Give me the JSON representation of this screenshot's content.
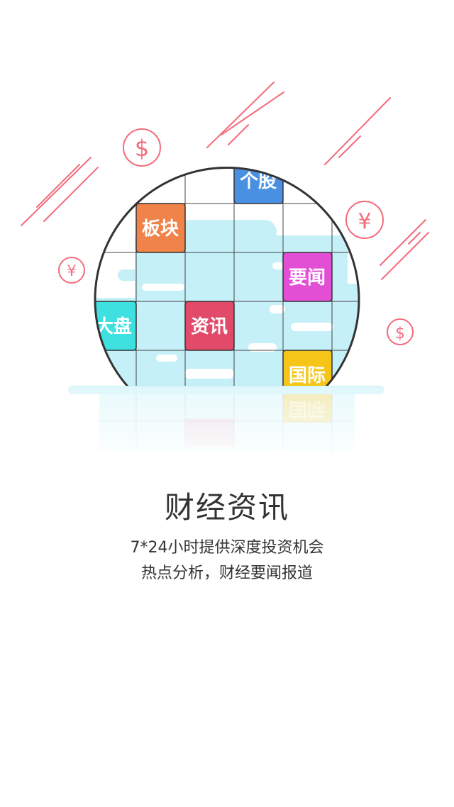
{
  "illustration": {
    "tiles": {
      "gegu": "个股",
      "bankuai": "板块",
      "yaowen": "要闻",
      "dapan": "大盘",
      "zixun": "资讯",
      "guoji": "国际"
    },
    "currency": {
      "dollar": "$",
      "yen": "¥"
    },
    "colors": {
      "gegu": "#4a90e2",
      "bankuai": "#f0834a",
      "yaowen": "#e24fd5",
      "dapan": "#3ee0e0",
      "zixun": "#e24a6a",
      "guoji": "#f5c518",
      "accent_lines": "#f36c7c",
      "water": "#c5f0f7"
    }
  },
  "content": {
    "title": "财经资讯",
    "subtitle_line1": "7*24小时提供深度投资机会",
    "subtitle_line2": "热点分析，财经要闻报道"
  }
}
